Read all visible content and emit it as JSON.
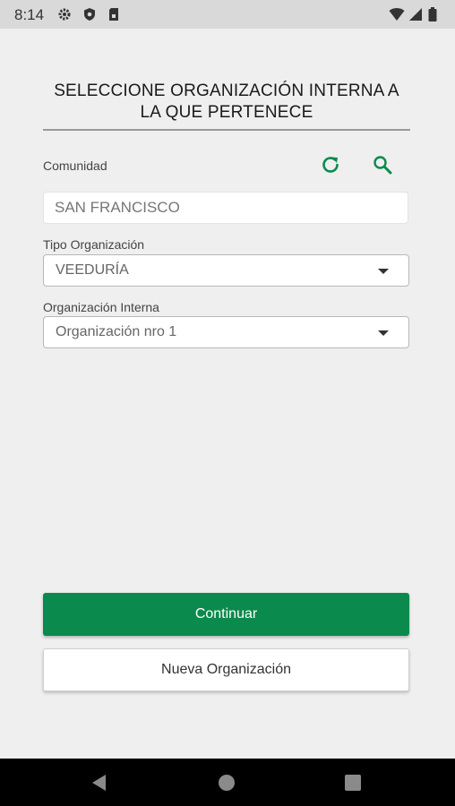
{
  "status_bar": {
    "time": "8:14",
    "left_icons": [
      "gear-icon",
      "shield-icon",
      "sim-card-icon"
    ],
    "right_icons": [
      "wifi-icon",
      "signal-icon",
      "battery-icon"
    ]
  },
  "page": {
    "title": "SELECCIONE ORGANIZACIÓN INTERNA A LA QUE PERTENECE"
  },
  "form": {
    "comunidad_label": "Comunidad",
    "comunidad_value": "SAN FRANCISCO",
    "tipo_label": "Tipo Organización",
    "tipo_value": "VEEDURÍA",
    "organizacion_label": "Organización Interna",
    "organizacion_value": "Organización nro 1"
  },
  "actions": {
    "continue_label": "Continuar",
    "new_org_label": "Nueva Organización"
  },
  "colors": {
    "accent": "#0a8a4c",
    "background": "#efefef"
  }
}
